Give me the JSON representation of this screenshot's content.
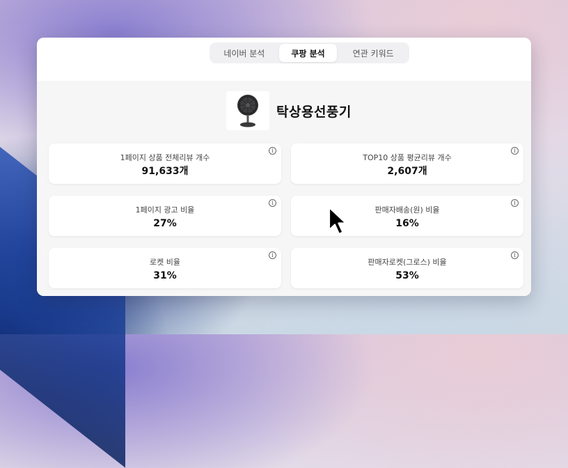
{
  "tabs": [
    {
      "label": "네이버 분석",
      "active": false
    },
    {
      "label": "쿠팡 분석",
      "active": true
    },
    {
      "label": "연관 키워드",
      "active": false
    }
  ],
  "product": {
    "name": "탁상용선풍기",
    "image_icon": "desk-fan-icon"
  },
  "stats": [
    {
      "label": "1페이지 상품 전체리뷰 개수",
      "value": "91,633개"
    },
    {
      "label": "TOP10 상품 평균리뷰 개수",
      "value": "2,607개"
    },
    {
      "label": "1페이지 광고 비율",
      "value": "27%"
    },
    {
      "label": "판매자배송(원) 비율",
      "value": "16%"
    },
    {
      "label": "로켓 비율",
      "value": "31%"
    },
    {
      "label": "판매자로켓(그로스) 비율",
      "value": "53%"
    }
  ],
  "info_icon": "i",
  "colors": {
    "panel_bg": "#f6f6f7",
    "tab_bar_bg": "#f0f0f2",
    "card_bg": "#ffffff",
    "text_primary": "#111111"
  }
}
